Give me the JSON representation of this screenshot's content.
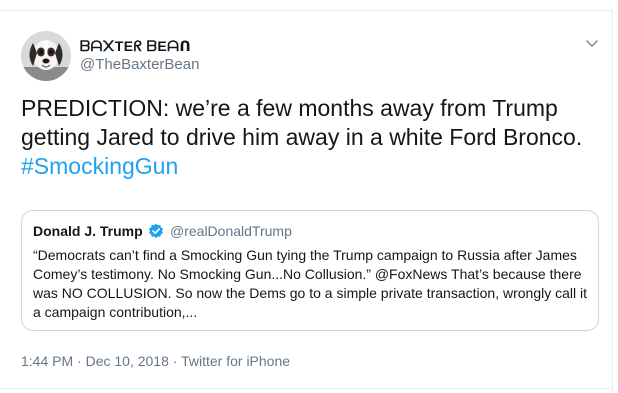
{
  "author": {
    "display_name": "ᗷᗩ᙭TEᖇ ᗷEᗩᑎ",
    "handle": "@TheBaxterBean",
    "avatar_icon": "dog-avatar-icon"
  },
  "menu": {
    "icon": "chevron-down-icon"
  },
  "tweet": {
    "text": "PREDICTION: we’re a few months away from Trump getting Jared to drive him away in a white Ford Bronco. ",
    "hashtag": "#SmockingGun"
  },
  "quoted": {
    "name": "Donald J. Trump",
    "verified_icon": "verified-badge-icon",
    "handle": "@realDonaldTrump",
    "text": "“Democrats can’t find a Smocking Gun tying the Trump campaign to Russia after James Comey’s testimony. No Smocking Gun...No Collusion.” @FoxNews  That’s because there was NO COLLUSION. So now the Dems go to a simple private transaction, wrongly call it a campaign contribution,..."
  },
  "meta": {
    "time": "1:44 PM",
    "separator": " · ",
    "date": "Dec 10, 2018",
    "source": "Twitter for iPhone"
  },
  "colors": {
    "link": "#1da1f2",
    "muted": "#657786",
    "border": "#ccd6dd",
    "text": "#14171a"
  }
}
